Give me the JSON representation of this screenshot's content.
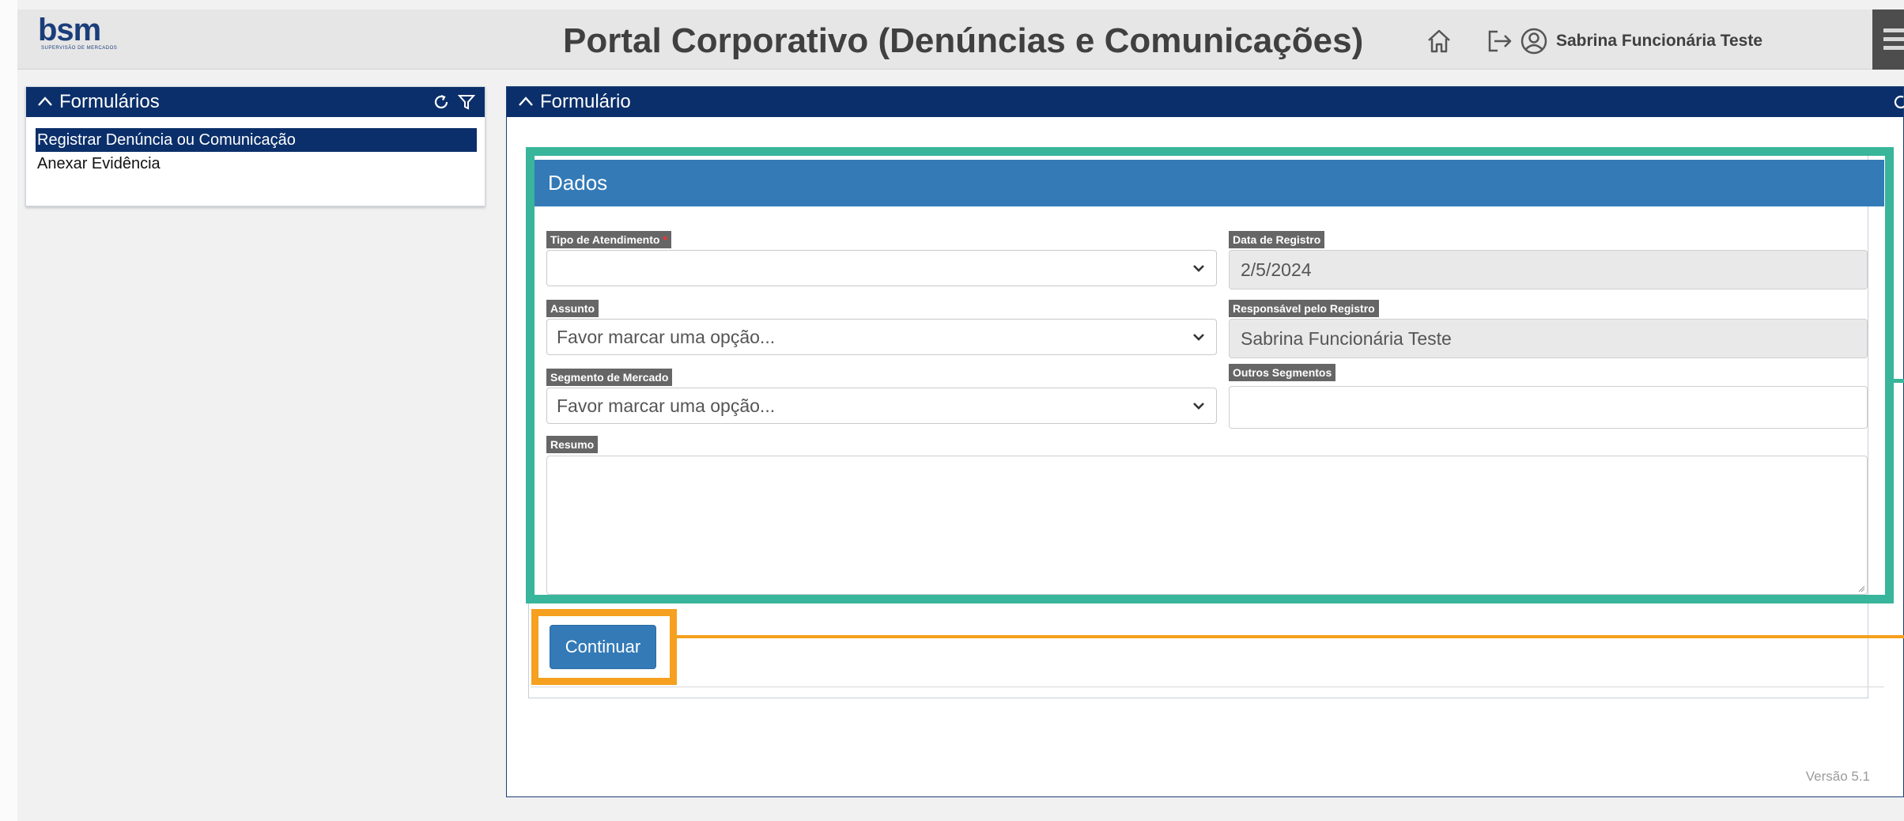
{
  "app": {
    "logo_text": "bsm",
    "logo_tagline": "SUPERVISÃO DE MERCADOS",
    "title": "Portal Corporativo (Denúncias e Comunicações)",
    "user_name": "Sabrina Funcionária Teste"
  },
  "icons": {
    "home": "home-icon",
    "logout": "logout-icon",
    "user": "user-circle-icon",
    "menu": "hamburger-menu-icon",
    "refresh": "refresh-icon",
    "filter": "filter-icon",
    "chevron_up": "chevron-up-icon",
    "chevron_down": "chevron-down-icon"
  },
  "sidebar": {
    "title": "Formulários",
    "items": [
      {
        "label": "Registrar Denúncia ou Comunicação",
        "selected": true
      },
      {
        "label": "Anexar Evidência",
        "selected": false
      }
    ]
  },
  "form": {
    "panel_title": "Formulário",
    "section_title": "Dados",
    "fields": {
      "tipo_atendimento": {
        "label": "Tipo de Atendimento",
        "required_mark": "*",
        "value": ""
      },
      "data_registro": {
        "label": "Data de Registro",
        "value": "2/5/2024"
      },
      "assunto": {
        "label": "Assunto",
        "value": "Favor marcar uma opção..."
      },
      "responsavel": {
        "label": "Responsável pelo Registro",
        "value": "Sabrina Funcionária Teste"
      },
      "segmento": {
        "label": "Segmento de Mercado",
        "value": "Favor marcar uma opção..."
      },
      "outros_segmentos": {
        "label": "Outros Segmentos",
        "value": ""
      },
      "resumo": {
        "label": "Resumo",
        "value": ""
      }
    },
    "continue_label": "Continuar",
    "version": "Versão 5.1"
  },
  "colors": {
    "navy": "#0b2f6a",
    "primary": "#337ab7",
    "highlight_green": "#38b59a",
    "highlight_orange": "#f5a01e",
    "label_grey": "#666666",
    "required_red": "#ff2e2e"
  }
}
